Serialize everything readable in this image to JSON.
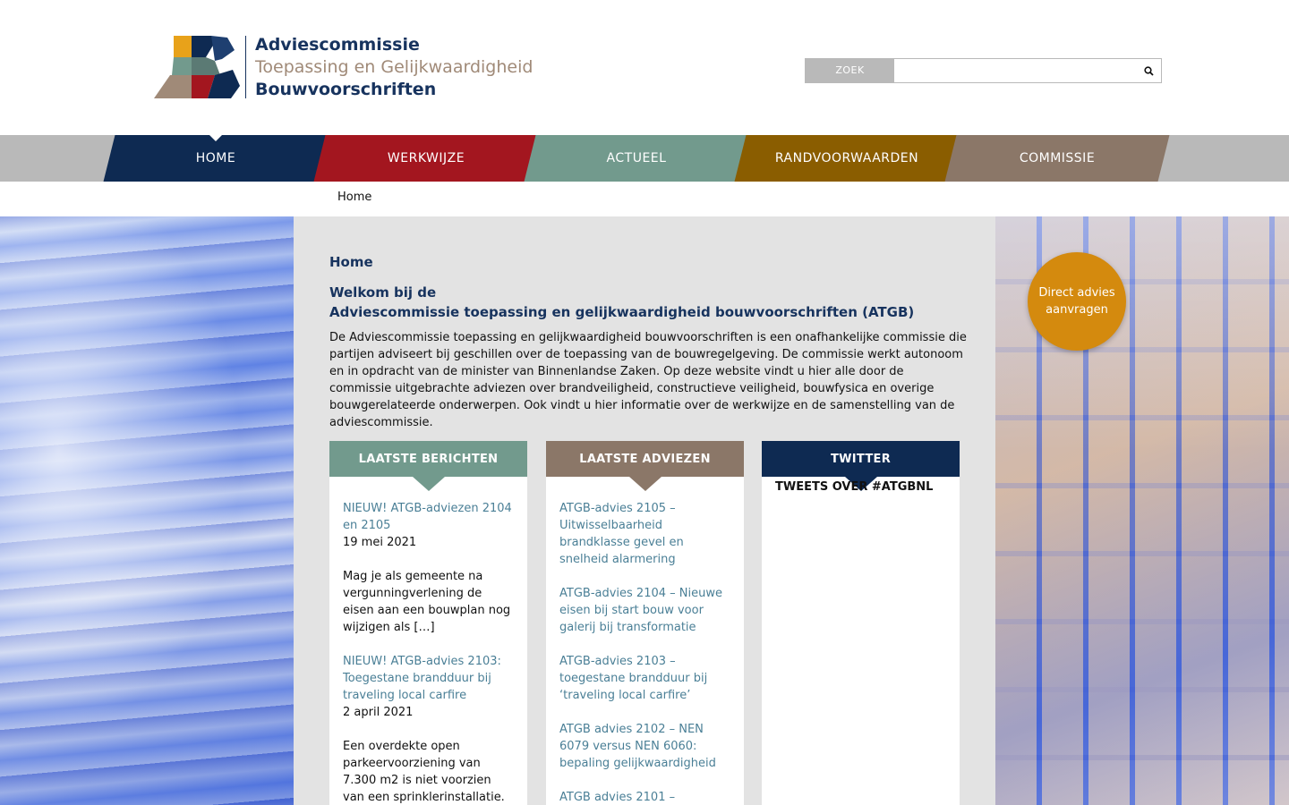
{
  "logo": {
    "line1": "Adviescommissie",
    "line2": "Toepassing en Gelijkwaardigheid",
    "line3": "Bouwvoorschriften"
  },
  "search": {
    "button_label": "ZOEK",
    "value": "",
    "icon": "search-icon"
  },
  "nav": {
    "items": [
      {
        "label": "HOME",
        "color": "#0e2a52",
        "active": true
      },
      {
        "label": "WERKWIJZE",
        "color": "#a3161f"
      },
      {
        "label": "ACTUEEL",
        "color": "#729a8d"
      },
      {
        "label": "RANDVOORWAARDEN",
        "color": "#8a5d00"
      },
      {
        "label": "COMMISSIE",
        "color": "#8b7768"
      }
    ]
  },
  "breadcrumb": "Home",
  "cta": {
    "label": "Direct advies aanvragen",
    "color": "#d48a0e"
  },
  "main": {
    "page_title": "Home",
    "welcome_line1": "Welkom bij de",
    "welcome_line2": "Adviescommissie toepassing en gelijkwaardigheid bouwvoorschriften (ATGB)",
    "intro": "De Adviescommissie toepassing en gelijkwaardigheid bouwvoorschriften is een onafhankelijke commissie die partijen adviseert bij geschillen over de toepassing van de bouwregelgeving. De commissie werkt autonoom en in opdracht van de minister van Binnenlandse Zaken. Op deze website vindt u hier alle door de commissie uitgebrachte adviezen over brandveiligheid, constructieve veiligheid, bouwfysica en overige bouwgerelateerde onderwerpen. Ook vindt u hier informatie over de werkwijze en de samenstelling van de adviescommissie."
  },
  "columns": {
    "berichten": {
      "title": "LAATSTE BERICHTEN",
      "color": "#729a8d",
      "posts": [
        {
          "title": "NIEUW! ATGB-adviezen 2104 en 2105",
          "date": "19 mei 2021",
          "excerpt": "Mag je als gemeente na vergunningverlening de eisen aan een bouwplan nog wijzigen als […]"
        },
        {
          "title": "NIEUW! ATGB-advies 2103: Toegestane brandduur bij traveling local carfire",
          "date": "2 april 2021",
          "excerpt": "Een overdekte open parkeervoorziening van 7.300 m2 is niet voorzien van een sprinklerinstallatie. Bij […]"
        }
      ]
    },
    "adviezen": {
      "title": "LAATSTE ADVIEZEN",
      "color": "#8b7768",
      "items": [
        "ATGB-advies 2105 – Uitwisselbaarheid brandklasse gevel en snelheid alarmering",
        "ATGB-advies 2104 – Nieuwe eisen bij start bouw voor galerij bij transformatie",
        "ATGB-advies 2103 – toegestane brandduur bij ‘traveling local carfire’",
        "ATGB advies 2102 – NEN 6079 versus NEN 6060: bepaling gelijkwaardigheid",
        "ATGB advies 2101 –"
      ]
    },
    "twitter": {
      "title": "TWITTER",
      "color": "#0e2a52",
      "subtitle": "TWEETS OVER #ATGBNL"
    }
  }
}
